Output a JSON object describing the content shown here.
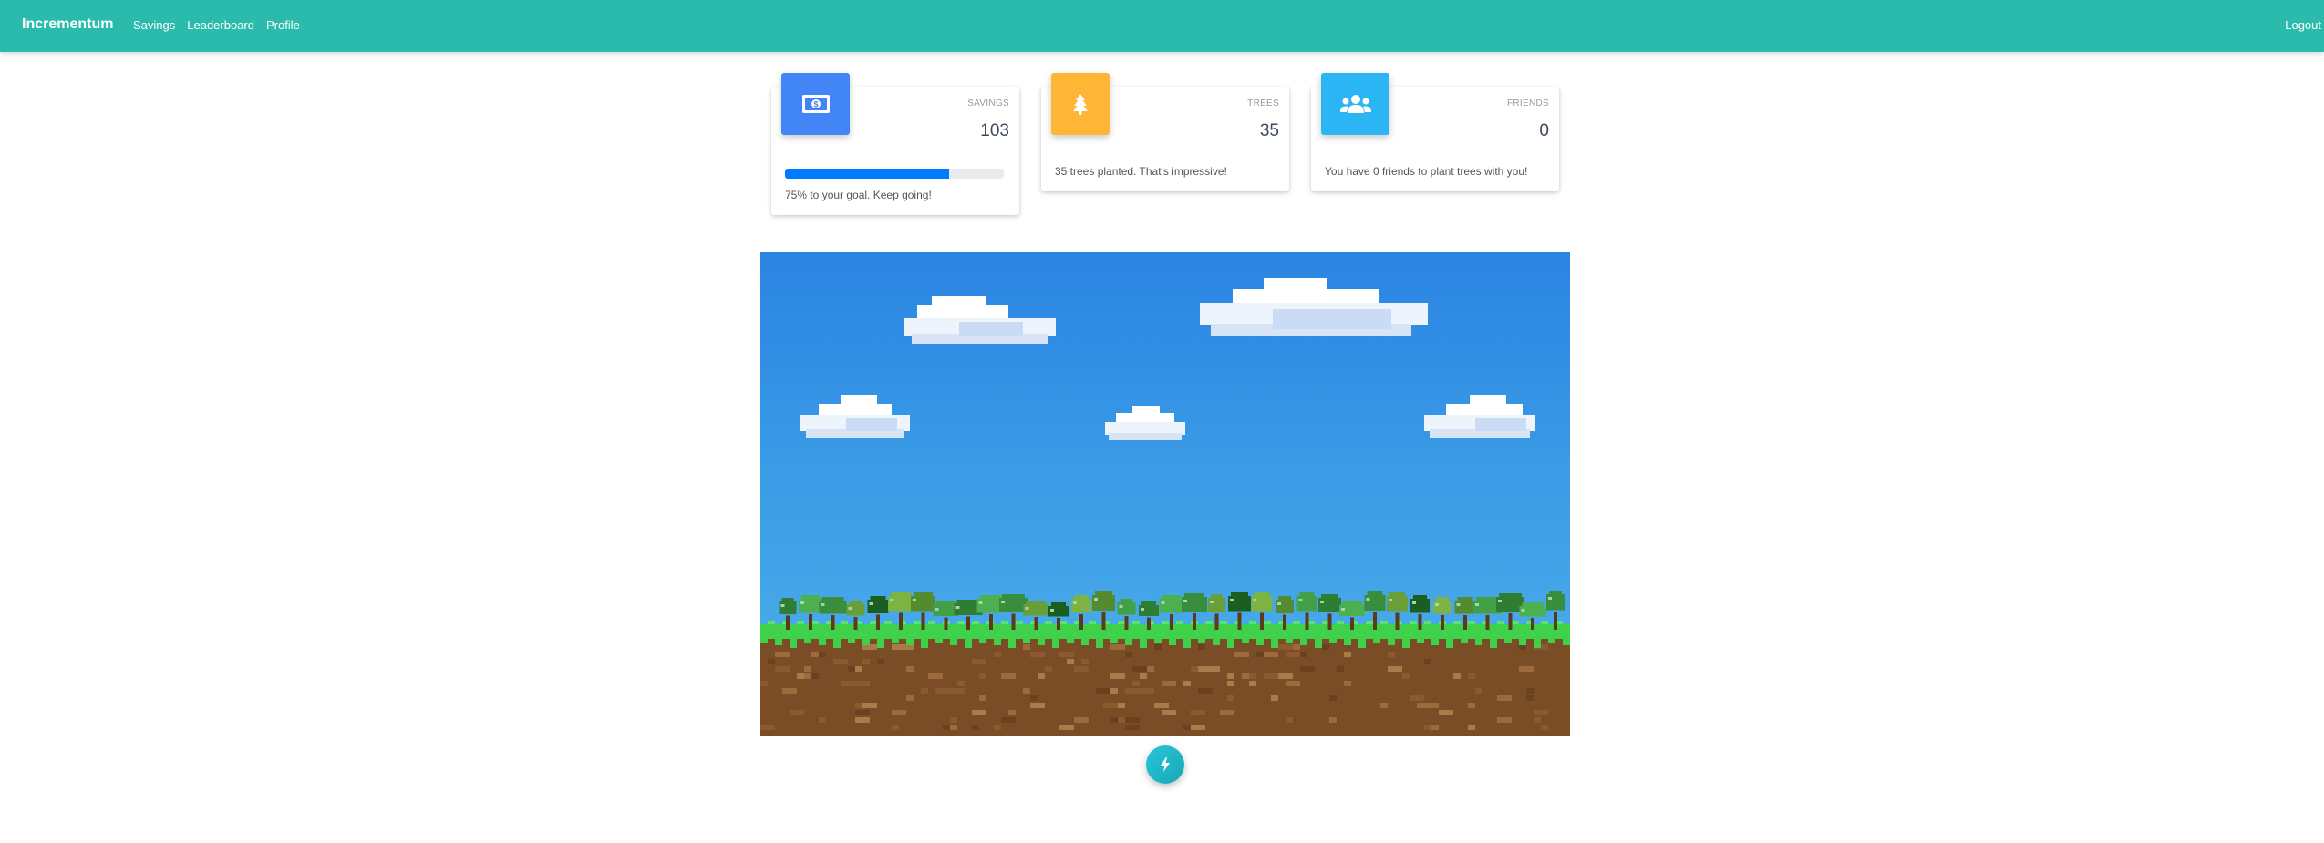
{
  "nav": {
    "brand": "Incrementum",
    "links": [
      "Savings",
      "Leaderboard",
      "Profile"
    ],
    "logout": "Logout"
  },
  "cards": {
    "savings": {
      "label": "SAVINGS",
      "value": "103",
      "progress": 0.75,
      "footer": "75% to your goal. Keep going!",
      "icon": "money-bill-icon",
      "color": "#4285f4"
    },
    "trees": {
      "label": "TREES",
      "value": "35",
      "footer": "35 trees planted. That's impressive!",
      "icon": "tree-icon",
      "color": "#ffb535"
    },
    "friends": {
      "label": "FRIENDS",
      "value": "0",
      "footer": "You have 0 friends to plant trees with you!",
      "icon": "users-icon",
      "color": "#2bb5f4"
    }
  },
  "scene": {
    "sky_color": "#2f8fe4",
    "grass_color": "#3fd14a",
    "dirt_color": "#7a4d27",
    "tree_count": 35
  },
  "action_button": {
    "icon": "lightning-bolt-icon",
    "color": "#26c6da"
  }
}
